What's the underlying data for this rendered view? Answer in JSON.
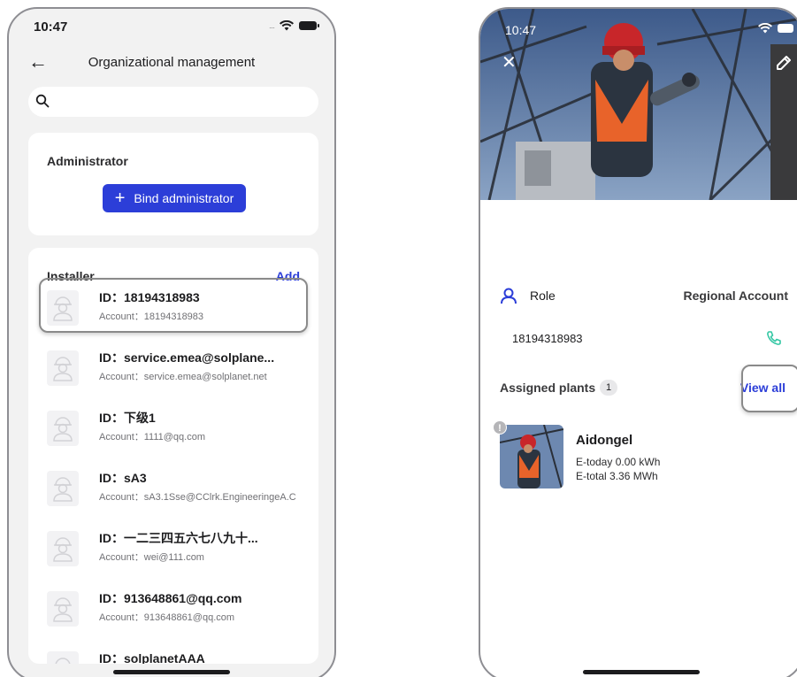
{
  "left_screen": {
    "status": {
      "time": "10:47",
      "signal_dots": "....",
      "wifi_icon": "wifi-icon",
      "battery_icon": "battery-icon"
    },
    "nav": {
      "back_icon": "back-arrow-icon",
      "title": "Organizational management"
    },
    "search": {
      "icon": "search-icon",
      "placeholder": ""
    },
    "administrator": {
      "title": "Administrator",
      "bind_button": "Bind administrator"
    },
    "installer": {
      "title": "Installer",
      "add_label": "Add",
      "items": [
        {
          "id": "ID：18194318983",
          "account": "Account：18194318983"
        },
        {
          "id": "ID：service.emea@solplane...",
          "account": "Account：service.emea@solplanet.net"
        },
        {
          "id": "ID：下级1",
          "account": "Account：1111@qq.com"
        },
        {
          "id": "ID：sA3",
          "account": "Account：sA3.1Sse@CClrk.EngineeringeA.C"
        },
        {
          "id": "ID：一二三四五六七八九十...",
          "account": "Account：wei@111.com"
        },
        {
          "id": "ID：913648861@qq.com",
          "account": "Account：913648861@qq.com"
        },
        {
          "id": "ID：solplanetAAA",
          "account": ""
        }
      ]
    }
  },
  "right_screen": {
    "status": {
      "time": "10:47"
    },
    "header": {
      "close_icon": "close-icon",
      "edit_icon": "edit-pencil-icon"
    },
    "role": {
      "label": "Role",
      "value": "Regional Account"
    },
    "phone": {
      "number": "18194318983",
      "icon": "phone-icon"
    },
    "assigned": {
      "label": "Assigned plants",
      "count": "1",
      "view_all": "View all"
    },
    "plant": {
      "name": "Aidongel",
      "warning": "!",
      "e_today": "E-today 0.00 kWh",
      "e_total": "E-total 3.36 MWh"
    }
  },
  "colors": {
    "accent": "#2c3ed8",
    "phone_green": "#34c7a4",
    "background": "#f2f2f2"
  }
}
